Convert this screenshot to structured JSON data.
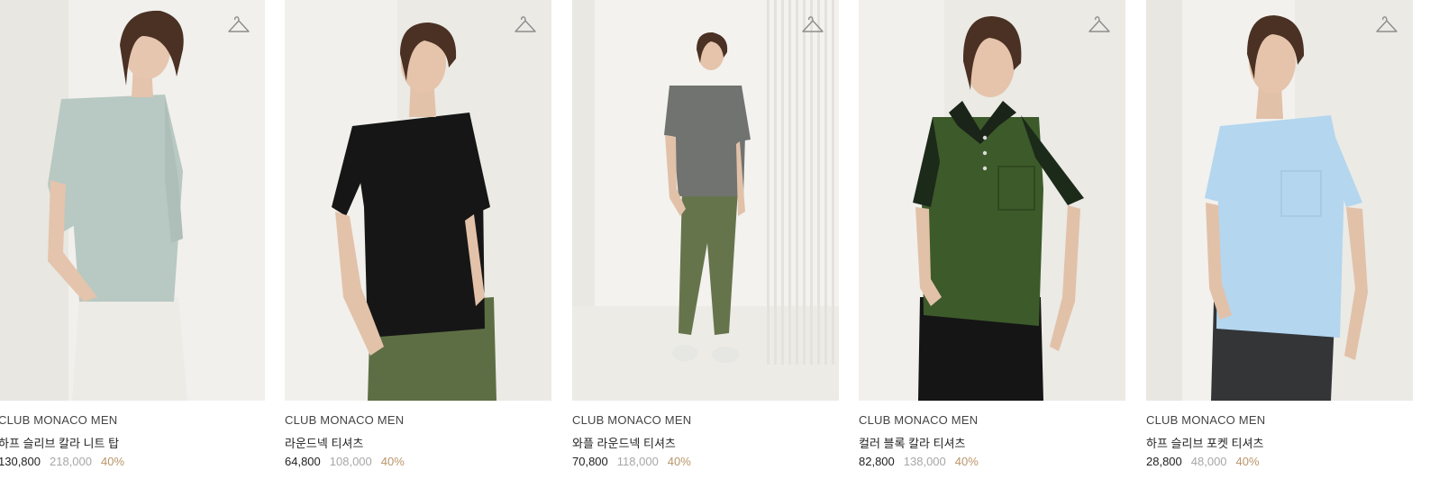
{
  "products": [
    {
      "brand": "CLUB MONACO MEN",
      "name": "하프 슬리브 칼라 니트 탑",
      "sale_price": "130,800",
      "original_price": "218,000",
      "discount": "40%",
      "shirt_color": "#b8c8c3",
      "pants_color": "#ecebe5",
      "icon": "hanger-icon"
    },
    {
      "brand": "CLUB MONACO MEN",
      "name": "라운드넥 티셔츠",
      "sale_price": "64,800",
      "original_price": "108,000",
      "discount": "40%",
      "shirt_color": "#161616",
      "pants_color": "#5e6e44",
      "icon": "hanger-icon"
    },
    {
      "brand": "CLUB MONACO MEN",
      "name": "와플 라운드넥 티셔츠",
      "sale_price": "70,800",
      "original_price": "118,000",
      "discount": "40%",
      "shirt_color": "#707370",
      "pants_color": "#66744c",
      "icon": "hanger-icon"
    },
    {
      "brand": "CLUB MONACO MEN",
      "name": "컬러 블록 칼라 티셔츠",
      "sale_price": "82,800",
      "original_price": "138,000",
      "discount": "40%",
      "shirt_color": "#3d5a2a",
      "pants_color": "#151515",
      "icon": "hanger-icon"
    },
    {
      "brand": "CLUB MONACO MEN",
      "name": "하프 슬리브 포켓 티셔츠",
      "sale_price": "28,800",
      "original_price": "48,000",
      "discount": "40%",
      "shirt_color": "#b4d6ef",
      "pants_color": "#333537",
      "icon": "hanger-icon"
    }
  ],
  "colors": {
    "background": "#ffffff",
    "photo_bg": "#f0efeb",
    "discount": "#b9956a",
    "original_price": "#a7a7a7"
  }
}
